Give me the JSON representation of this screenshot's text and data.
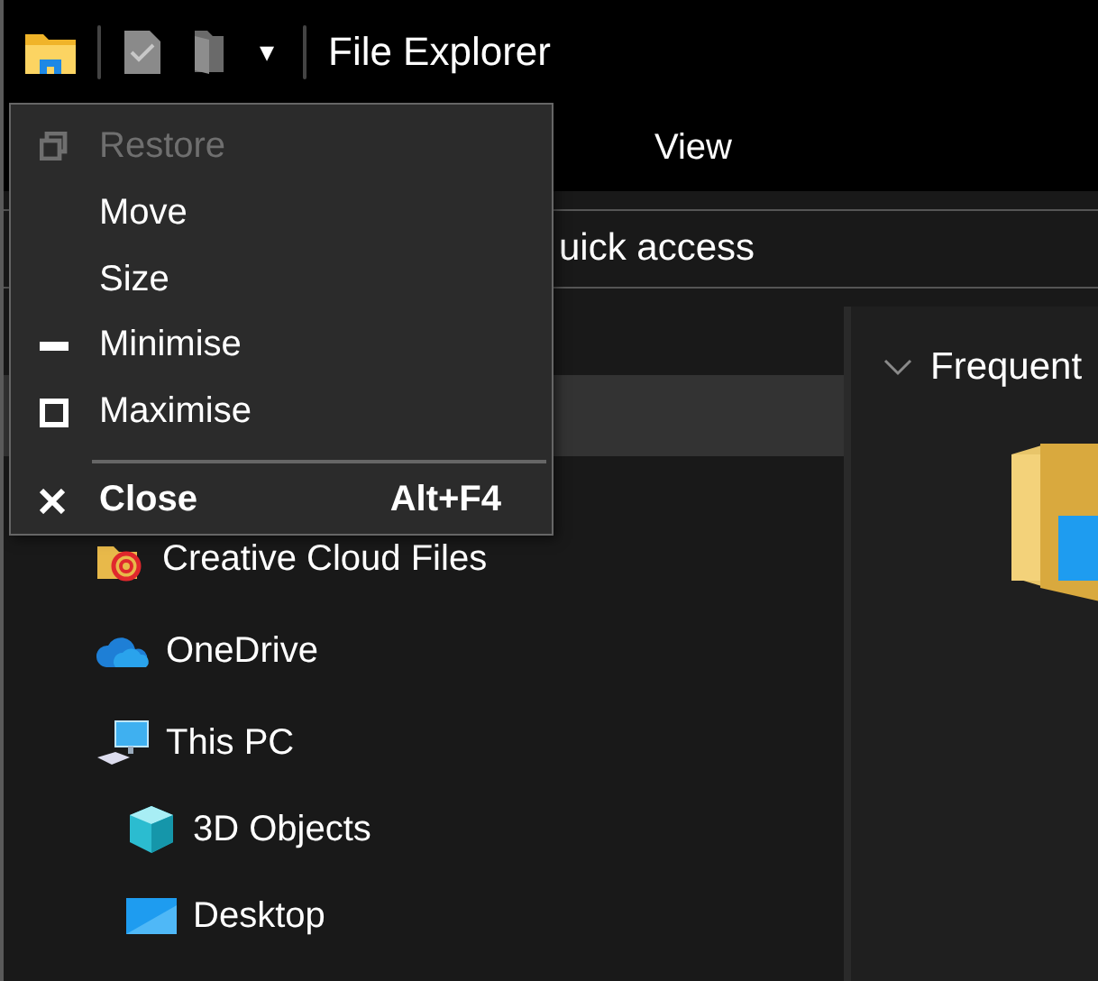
{
  "title_bar": {
    "title": "File Explorer",
    "quick_access_caret": "▾"
  },
  "ribbon": {
    "tabs": [
      {
        "label": "View",
        "selected": false
      }
    ]
  },
  "address_bar": {
    "path": "uick access"
  },
  "nav": {
    "hidden_selected_row": true,
    "items": [
      {
        "label": "Creative Cloud Files",
        "kind": "cloudfiles",
        "selected": false
      },
      {
        "label": "OneDrive",
        "kind": "onedrive",
        "selected": false
      },
      {
        "label": "This PC",
        "kind": "pc",
        "selected": false,
        "children": [
          {
            "label": "3D Objects",
            "kind": "cube",
            "selected": false
          },
          {
            "label": "Desktop",
            "kind": "desktop",
            "selected": false
          }
        ]
      }
    ]
  },
  "content": {
    "groups": [
      {
        "label": "Frequent",
        "expanded": true
      }
    ]
  },
  "system_menu": {
    "items": [
      {
        "kind": "restore",
        "label": "Restore",
        "disabled": true,
        "default": false
      },
      {
        "kind": "move",
        "label": "Move",
        "disabled": false,
        "default": false
      },
      {
        "kind": "size",
        "label": "Size",
        "disabled": false,
        "default": false
      },
      {
        "kind": "minimise",
        "label": "Minimise",
        "disabled": false,
        "default": false
      },
      {
        "kind": "maximise",
        "label": "Maximise",
        "disabled": false,
        "default": false
      },
      {
        "kind": "separator"
      },
      {
        "kind": "close",
        "label": "Close",
        "disabled": false,
        "default": true,
        "shortcut": "Alt+F4"
      }
    ]
  }
}
